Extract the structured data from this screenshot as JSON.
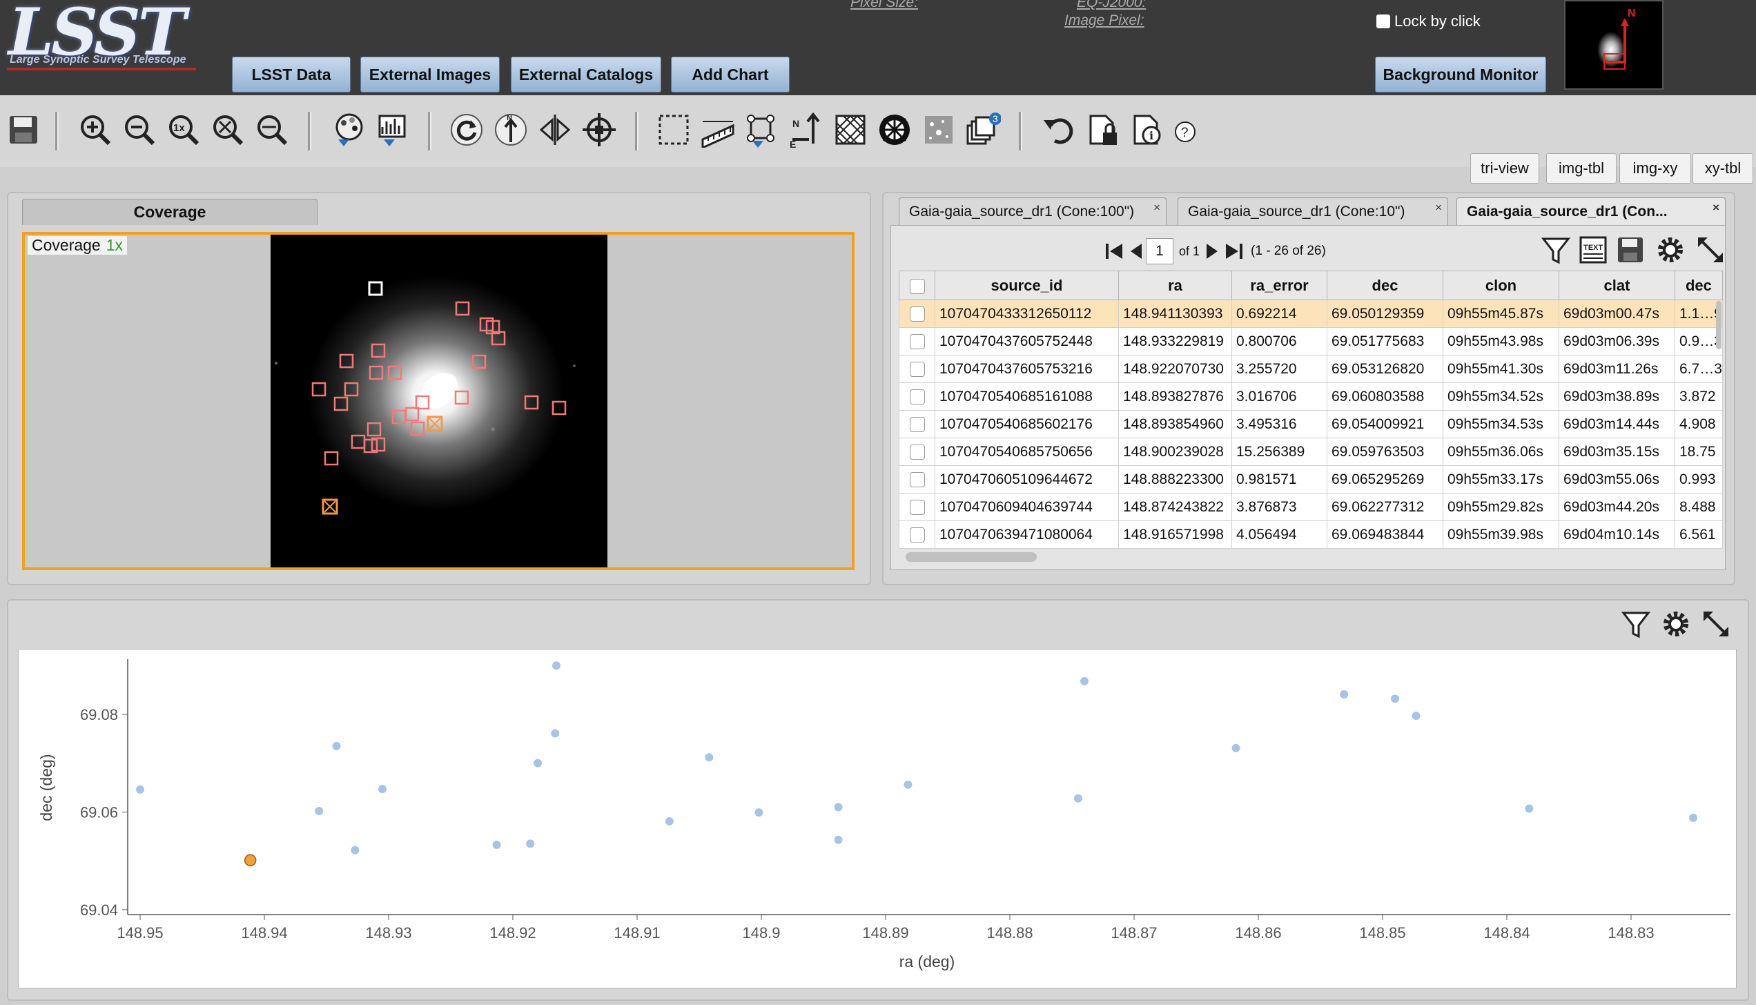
{
  "header": {
    "logo_text": "LSST",
    "logo_subtitle": "Large Synoptic Survey Telescope",
    "buttons": [
      "LSST Data",
      "External Images",
      "External Catalogs",
      "Add Chart"
    ],
    "pixel_size_label": "Pixel Size:",
    "coord_system_label": "EQ-J2000:",
    "image_pixel_label": "Image Pixel:",
    "lock_label": "Lock by click",
    "background_monitor_label": "Background Monitor",
    "thumbnail_north": "N"
  },
  "toolbar": {
    "icons": [
      "save-icon",
      "zoom-in-icon",
      "zoom-out-icon",
      "zoom-1x-icon",
      "zoom-fit-icon",
      "zoom-fill-icon",
      "color-palette-icon",
      "stretch-icon",
      "rotate-icon",
      "rotate-north-icon",
      "flip-icon",
      "recenter-icon",
      "select-area-icon",
      "distance-tool-icon",
      "region-edit-icon",
      "overlay-north-arrow-icon",
      "grid-overlay-icon",
      "mask-icon",
      "catalog-overlay-icon",
      "layers-icon",
      "restore-icon",
      "lock-image-icon",
      "image-info-icon",
      "help-icon"
    ],
    "layers_count": "3"
  },
  "view_modes": [
    "tri-view",
    "img-tbl",
    "img-xy",
    "xy-tbl"
  ],
  "coverage": {
    "tab_label": "Coverage",
    "label": "Coverage",
    "zoom": "1x"
  },
  "table": {
    "tabs": [
      {
        "label": "Gaia-gaia_source_dr1 (Cone:100\")",
        "active": false
      },
      {
        "label": "Gaia-gaia_source_dr1 (Cone:10\")",
        "active": false
      },
      {
        "label": "Gaia-gaia_source_dr1 (Con...",
        "active": true
      }
    ],
    "close_glyph": "×",
    "pager": {
      "page": "1",
      "of": "of 1",
      "range": "(1 - 26 of 26)"
    },
    "columns": [
      "source_id",
      "ra",
      "ra_error",
      "dec",
      "clon",
      "clat",
      "dec"
    ],
    "rows": [
      [
        "1070470433312650112",
        "148.941130393",
        "0.692214",
        "69.050129359",
        "09h55m45.87s",
        "69d03m00.47s",
        "1.1…9"
      ],
      [
        "1070470437605752448",
        "148.933229819",
        "0.800706",
        "69.051775683",
        "09h55m43.98s",
        "69d03m06.39s",
        "0.9…3"
      ],
      [
        "1070470437605753216",
        "148.922070730",
        "3.255720",
        "69.053126820",
        "09h55m41.30s",
        "69d03m11.26s",
        "6.7…3"
      ],
      [
        "1070470540685161088",
        "148.893827876",
        "3.016706",
        "69.060803588",
        "09h55m34.52s",
        "69d03m38.89s",
        "3.872"
      ],
      [
        "1070470540685602176",
        "148.893854960",
        "3.495316",
        "69.054009921",
        "09h55m34.53s",
        "69d03m14.44s",
        "4.908"
      ],
      [
        "1070470540685750656",
        "148.900239028",
        "15.256389",
        "69.059763503",
        "09h55m36.06s",
        "69d03m35.15s",
        "18.75"
      ],
      [
        "1070470605109644672",
        "148.888223300",
        "0.981571",
        "69.065295269",
        "09h55m33.17s",
        "69d03m55.06s",
        "0.993"
      ],
      [
        "1070470609404639744",
        "148.874243822",
        "3.876873",
        "69.062277312",
        "09h55m29.82s",
        "69d03m44.20s",
        "8.488"
      ],
      [
        "1070470639471080064",
        "148.916571998",
        "4.056494",
        "69.069483844",
        "09h55m39.98s",
        "69d04m10.14s",
        "6.561"
      ]
    ],
    "selected_row": 0
  },
  "chart_data": {
    "type": "scatter",
    "xlabel": "ra (deg)",
    "ylabel": "dec (deg)",
    "xlim": [
      148.951,
      148.822
    ],
    "ylim": [
      69.039,
      69.0913
    ],
    "x_reversed": true,
    "xticks": [
      "148.95",
      "148.94",
      "148.93",
      "148.92",
      "148.91",
      "148.9",
      "148.89",
      "148.88",
      "148.87",
      "148.86",
      "148.85",
      "148.84",
      "148.83"
    ],
    "yticks": [
      "69.08",
      "69.06",
      "69.04"
    ],
    "points_x": [
      148.95,
      148.9356,
      148.9342,
      148.9327,
      148.9305,
      148.9213,
      148.9186,
      148.918,
      148.9166,
      148.9165,
      148.9074,
      148.9042,
      148.9002,
      148.8938,
      148.8938,
      148.8882,
      148.8745,
      148.874,
      148.8618,
      148.8531,
      148.849,
      148.8473,
      148.8382,
      148.825
    ],
    "points_y": [
      69.0646,
      69.0602,
      69.0735,
      69.0522,
      69.0647,
      69.0533,
      69.0535,
      69.07,
      69.0761,
      69.09,
      69.0581,
      69.0712,
      69.0599,
      69.061,
      69.0543,
      69.0656,
      69.0628,
      69.0868,
      69.0731,
      69.0841,
      69.0832,
      69.0797,
      69.0607,
      69.0588
    ],
    "highlighted": {
      "x": 148.941130393,
      "y": 69.050129359
    },
    "point_color": "#a7c4e4",
    "highlight_color": "#f0a13a"
  },
  "coverage_markers": {
    "type": "overlay",
    "symbol": "square",
    "color": "#f07a7a",
    "selected_color": "#f09a4a"
  }
}
